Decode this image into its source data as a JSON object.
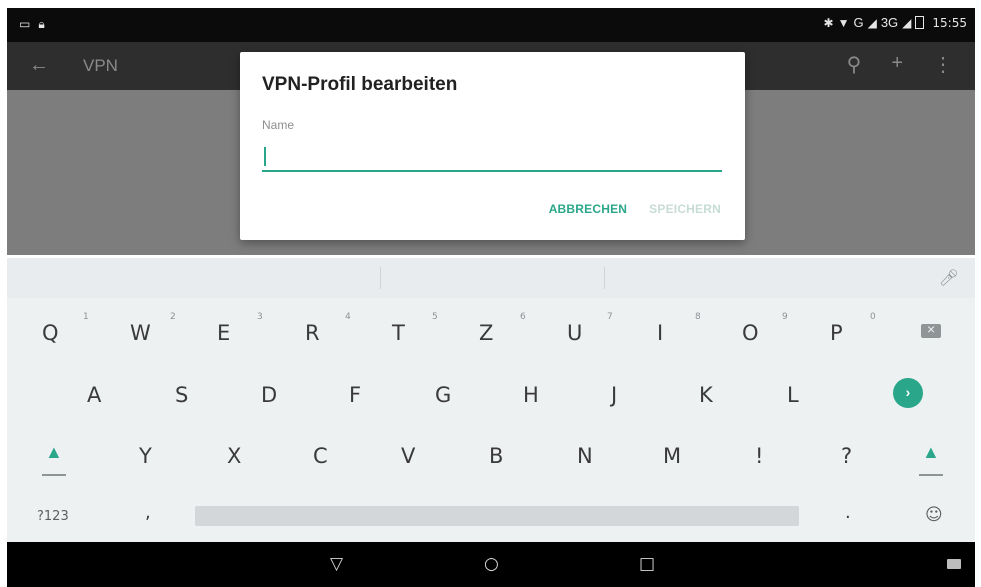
{
  "status_bar": {
    "time": "15:55",
    "network_label_g": "G",
    "network_label_3g": "3G"
  },
  "toolbar": {
    "title": "VPN"
  },
  "dialog": {
    "title": "VPN-Profil bearbeiten",
    "name_label": "Name",
    "name_value": "",
    "cancel_label": "ABBRECHEN",
    "save_label": "SPEICHERN"
  },
  "keyboard": {
    "row1": [
      {
        "key": "Q",
        "hint": "1"
      },
      {
        "key": "W",
        "hint": "2"
      },
      {
        "key": "E",
        "hint": "3"
      },
      {
        "key": "R",
        "hint": "4"
      },
      {
        "key": "T",
        "hint": "5"
      },
      {
        "key": "Z",
        "hint": "6"
      },
      {
        "key": "U",
        "hint": "7"
      },
      {
        "key": "I",
        "hint": "8"
      },
      {
        "key": "O",
        "hint": "9"
      },
      {
        "key": "P",
        "hint": "0"
      }
    ],
    "row2": [
      "A",
      "S",
      "D",
      "F",
      "G",
      "H",
      "J",
      "K",
      "L"
    ],
    "row3": [
      "Y",
      "X",
      "C",
      "V",
      "B",
      "N",
      "M",
      "!",
      "?"
    ],
    "symbols_label": "?123",
    "comma_label": ",",
    "period_label": "."
  },
  "icons": {
    "back": "arrow-left-icon",
    "search": "search-icon",
    "add": "plus-icon",
    "overflow": "more-vert-icon",
    "mic": "mic-icon",
    "backspace": "backspace-icon",
    "enter": "enter-icon",
    "shift": "shift-icon",
    "emoji": "emoji-icon",
    "nav_back": "nav-back-icon",
    "nav_home": "nav-home-icon",
    "nav_recents": "nav-recents-icon",
    "keyboard_switch": "keyboard-icon"
  },
  "colors": {
    "accent": "#2aa78a",
    "toolbar": "#2e2e2e",
    "scrim": "#7d7d7d"
  }
}
